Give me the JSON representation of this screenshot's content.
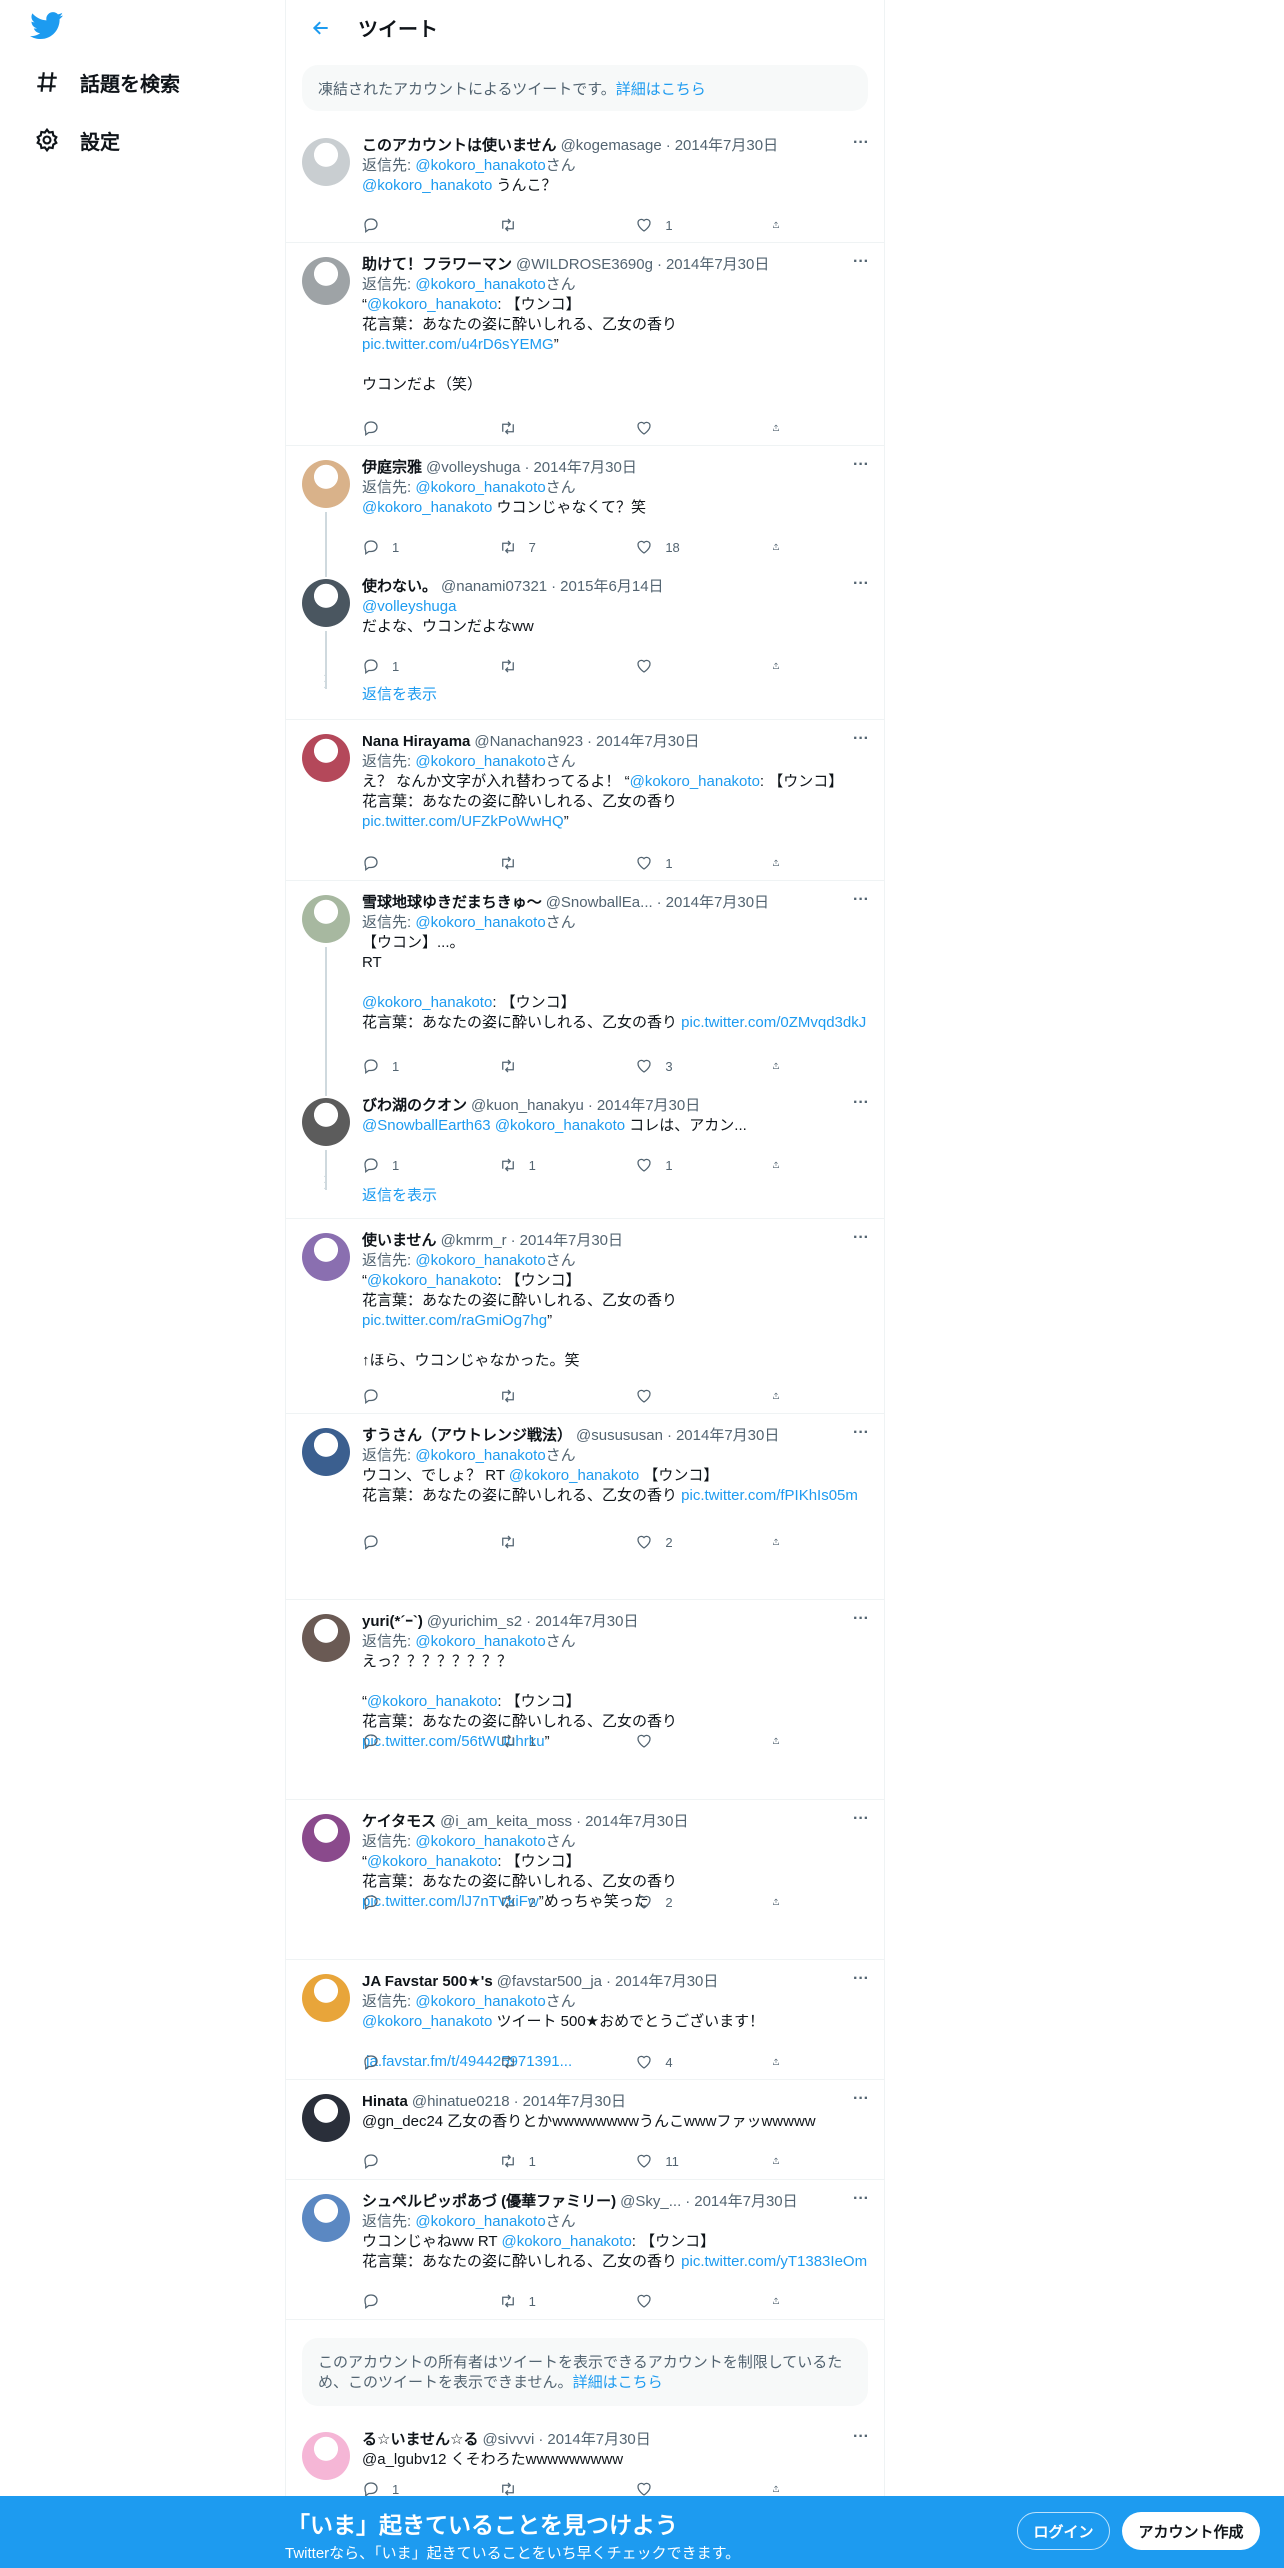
{
  "sidebar": {
    "logo": "twitter-bird-icon",
    "items": [
      {
        "label": "話題を検索",
        "icon": "hashtag-icon"
      },
      {
        "label": "設定",
        "icon": "gear-icon"
      }
    ]
  },
  "header": {
    "title": "ツイート",
    "back_icon": "arrow-left-icon"
  },
  "notice_top": {
    "text": "凍結されたアカウントによるツイートです。",
    "link": "詳細はこちら"
  },
  "notice_restricted": {
    "text": "このアカウントの所有者はツイートを表示できるアカウントを制限しているため、このツイートを表示できません。",
    "link": "詳細はこちら"
  },
  "show_replies": "返信を表示",
  "reply_prefix": "返信先: ",
  "reply_suffix": "さん",
  "tweets": [
    {
      "name": "このアカウントは使いません",
      "handle": "@kogemasage",
      "date": "2014年7月30日",
      "reply_to": "@kokoro_hanakoto",
      "mention": "@kokoro_hanakoto",
      "text": " うんこ？",
      "replies": "",
      "retweets": "",
      "likes": "1"
    },
    {
      "name": "助けて！フラワーマン",
      "handle": "@WILDROSE3690g",
      "date": "2014年7月30日",
      "reply_to": "@kokoro_hanakoto",
      "q1": "“",
      "mention": "@kokoro_hanakoto",
      "text": ": 【ウンコ】\n花言葉：あなたの姿に酔いしれる、乙女の香り",
      "link": "pic.twitter.com/u4rD6sYEMG",
      "text2": "”\n\nウコンだよ（笑）",
      "replies": "",
      "retweets": "",
      "likes": ""
    },
    {
      "name": "伊庭宗雅",
      "handle": "@volleyshuga",
      "date": "2014年7月30日",
      "reply_to": "@kokoro_hanakoto",
      "mention": "@kokoro_hanakoto",
      "text": " ウコンじゃなくて？笑",
      "replies": "1",
      "retweets": "7",
      "likes": "18"
    },
    {
      "name": "使わない。",
      "handle": "@nanami07321",
      "date": "2015年6月14日",
      "mention": "@volleyshuga",
      "text": "だよな、ウコンだよなww",
      "replies": "1",
      "retweets": "",
      "likes": ""
    },
    {
      "name": "Nana Hirayama",
      "handle": "@Nanachan923",
      "date": "2014年7月30日",
      "reply_to": "@kokoro_hanakoto",
      "text_pre": "え？ なんか文字が入れ替わってるよ！ “",
      "mention": "@kokoro_hanakoto",
      "text": ": 【ウンコ】\n花言葉：あなたの姿に酔いしれる、乙女の香り",
      "link": "pic.twitter.com/UFZkPoWwHQ",
      "text2": "”",
      "replies": "",
      "retweets": "",
      "likes": "1"
    },
    {
      "name": "雪球地球ゆきだまちきゅ〜",
      "handle": "@SnowballEa...",
      "date": "2014年7月30日",
      "reply_to": "@kokoro_hanakoto",
      "text_pre": "【ウコン】...。\nRT\n\n",
      "mention": "@kokoro_hanakoto",
      "text": ": 【ウンコ】\n花言葉：あなたの姿に酔いしれる、乙女の香り ",
      "link": "pic.twitter.com/0ZMvqd3dkJ",
      "replies": "1",
      "retweets": "",
      "likes": "3"
    },
    {
      "name": "びわ湖のクオン",
      "handle": "@kuon_hanakyu",
      "date": "2014年7月30日",
      "mention": "@SnowballEarth63",
      "mention2": "@kokoro_hanakoto",
      "text": " コレは、アカン...",
      "replies": "1",
      "retweets": "1",
      "likes": "1"
    },
    {
      "name": "使いません",
      "handle": "@kmrm_r",
      "date": "2014年7月30日",
      "reply_to": "@kokoro_hanakoto",
      "q1": "“",
      "mention": "@kokoro_hanakoto",
      "text": ": 【ウンコ】\n花言葉：あなたの姿に酔いしれる、乙女の香り",
      "link": "pic.twitter.com/raGmiOg7hg",
      "text2": "”\n\n↑ほら、ウコンじゃなかった。笑",
      "replies": "",
      "retweets": "",
      "likes": ""
    },
    {
      "name": "すうさん（アウトレンジ戦法）",
      "handle": "@susususan",
      "date": "2014年7月30日",
      "reply_to": "@kokoro_hanakoto",
      "text_pre": "ウコン、でしょ？ RT ",
      "mention": "@kokoro_hanakoto",
      "text": " 【ウンコ】\n花言葉：あなたの姿に酔いしれる、乙女の香り ",
      "link": "pic.twitter.com/fPIKhIs05m",
      "replies": "",
      "retweets": "",
      "likes": "2"
    },
    {
      "name": "yuri(*´ｰ`)",
      "handle": "@yurichim_s2",
      "date": "2014年7月30日",
      "reply_to": "@kokoro_hanakoto",
      "text_pre": "えっ？？？？？？？？\n\n“",
      "mention": "@kokoro_hanakoto",
      "text": ": 【ウンコ】\n花言葉：あなたの姿に酔いしれる、乙女の香り",
      "link": "pic.twitter.com/56tWUuhrku",
      "text2": "”",
      "replies": "",
      "retweets": "1",
      "likes": ""
    },
    {
      "name": "ケイタモス",
      "handle": "@i_am_keita_moss",
      "date": "2014年7月30日",
      "reply_to": "@kokoro_hanakoto",
      "q1": "“",
      "mention": "@kokoro_hanakoto",
      "text": ": 【ウンコ】\n花言葉：あなたの姿に酔いしれる、乙女の香り",
      "link": "pic.twitter.com/lJ7nTVkiFw",
      "text2": "”めっちゃ笑った",
      "replies": "",
      "retweets": "2",
      "likes": "2"
    },
    {
      "name": "JA Favstar 500★'s",
      "handle": "@favstar500_ja",
      "date": "2014年7月30日",
      "reply_to": "@kokoro_hanakoto",
      "mention": "@kokoro_hanakoto",
      "text": " ツイート 500★おめでとうございます！\n\n ",
      "link": "ja.favstar.fm/t/494425971391...",
      "replies": "",
      "retweets": "",
      "likes": "4"
    },
    {
      "name": "Hinata",
      "handle": "@hinatue0218",
      "date": "2014年7月30日",
      "text": "@gn_dec24 乙女の香りとかwwwwwwwwうんこwwwファッwwwww",
      "replies": "",
      "retweets": "1",
      "likes": "11"
    },
    {
      "name": "シュペルピッポあづ (優華ファミリー)",
      "handle": "@Sky_...",
      "date": "2014年7月30日",
      "reply_to": "@kokoro_hanakoto",
      "text_pre": "ウコンじゃねww RT ",
      "mention": "@kokoro_hanakoto",
      "text": ": 【ウンコ】\n花言葉：あなたの姿に酔いしれる、乙女の香り ",
      "link": "pic.twitter.com/yT1383IeOm",
      "replies": "",
      "retweets": "1",
      "likes": ""
    },
    {
      "name": "る☆いません☆る",
      "handle": "@sivvvi",
      "date": "2014年7月30日",
      "text": "@a_lgubv12 くそわろたwwwwwwwww",
      "replies": "1",
      "retweets": "",
      "likes": ""
    }
  ],
  "bottom_bar": {
    "title": "「いま」起きていることを見つけよう",
    "subtitle": "Twitterなら、「いま」起きていることをいち早くチェックできます。",
    "login": "ログイン",
    "signup": "アカウント作成"
  },
  "colors": {
    "accent": "#1d9bf0",
    "text": "#0f1419",
    "muted": "#536471"
  }
}
